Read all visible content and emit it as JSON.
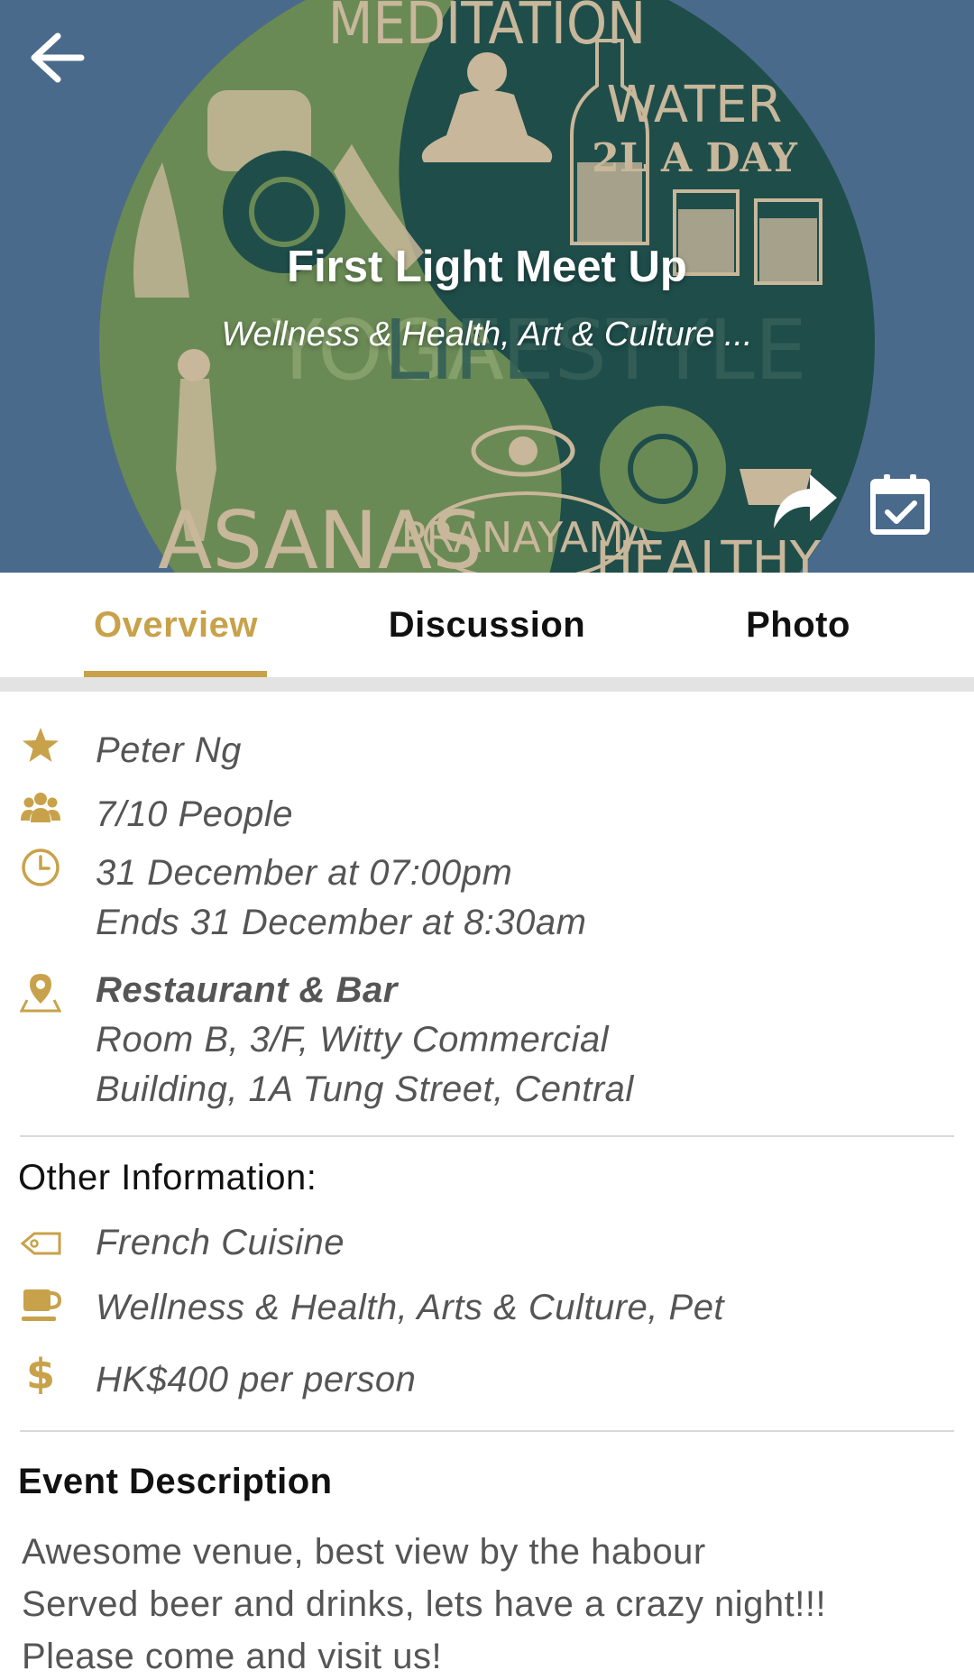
{
  "hero": {
    "title": "First Light Meet Up",
    "subtitle": "Wellness & Health, Art & Culture ...",
    "art_words": [
      "MEDITATION",
      "WATER",
      "2L A DAY",
      "YOGA",
      "LIFESTYLE",
      "ASANAS",
      "PRANAYAMA",
      "HEALTHY"
    ],
    "icons": {
      "back": "arrow-left-icon",
      "share": "share-icon",
      "calendar": "calendar-check-icon"
    }
  },
  "tabs": [
    {
      "label": "Overview",
      "active": true
    },
    {
      "label": "Discussion",
      "active": false
    },
    {
      "label": "Photo",
      "active": false
    }
  ],
  "details": {
    "host": "Peter Ng",
    "people": "7/10 People",
    "start": "31 December at 07:00pm",
    "end": "Ends 31 December at 8:30am",
    "venue_name": "Restaurant & Bar",
    "venue_address_line1": "Room B, 3/F, Witty Commercial",
    "venue_address_line2": "Building, 1A Tung Street, Central"
  },
  "other_info": {
    "heading": "Other Information:",
    "cuisine": "French Cuisine",
    "categories": "Wellness & Health, Arts & Culture, Pet",
    "price": "HK$400 per person"
  },
  "description": {
    "heading": "Event Description",
    "lines": [
      "Awesome venue, best view by the habour",
      "Served beer and drinks, lets have a crazy night!!!",
      "Please come and visit us!"
    ]
  },
  "colors": {
    "accent": "#c8a24a",
    "hero_bg": "#4a6a8c",
    "circle_dark": "#1f4d4a",
    "circle_green": "#6a8a55",
    "beige": "#c8b79a"
  }
}
